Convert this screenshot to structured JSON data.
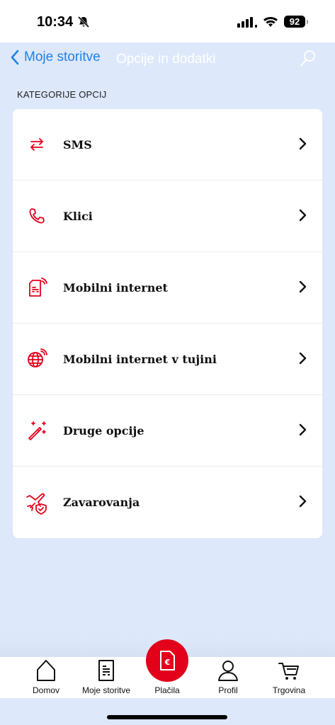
{
  "status_bar": {
    "time": "10:34",
    "battery": "92"
  },
  "nav": {
    "back_label": "Moje storitve",
    "title": "Opcije in dodatki"
  },
  "section": {
    "heading": "KATEGORIJE OPCIJ"
  },
  "categories": [
    {
      "label": "SMS",
      "icon": "arrows-exchange-icon"
    },
    {
      "label": "Klici",
      "icon": "phone-icon"
    },
    {
      "label": "Mobilni internet",
      "icon": "sim-signal-icon"
    },
    {
      "label": "Mobilni internet v tujini",
      "icon": "globe-signal-icon"
    },
    {
      "label": "Druge opcije",
      "icon": "magic-wand-icon"
    },
    {
      "label": "Zavarovanja",
      "icon": "plane-shield-icon"
    }
  ],
  "tabs": [
    {
      "label": "Domov",
      "icon": "home-icon"
    },
    {
      "label": "Moje storitve",
      "icon": "document-icon"
    },
    {
      "label": "Plačila",
      "icon": "euro-document-icon"
    },
    {
      "label": "Profil",
      "icon": "user-icon"
    },
    {
      "label": "Trgovina",
      "icon": "cart-icon"
    }
  ],
  "colors": {
    "accent": "#e2001a",
    "link": "#1f82e6",
    "background": "#dde8fb"
  }
}
